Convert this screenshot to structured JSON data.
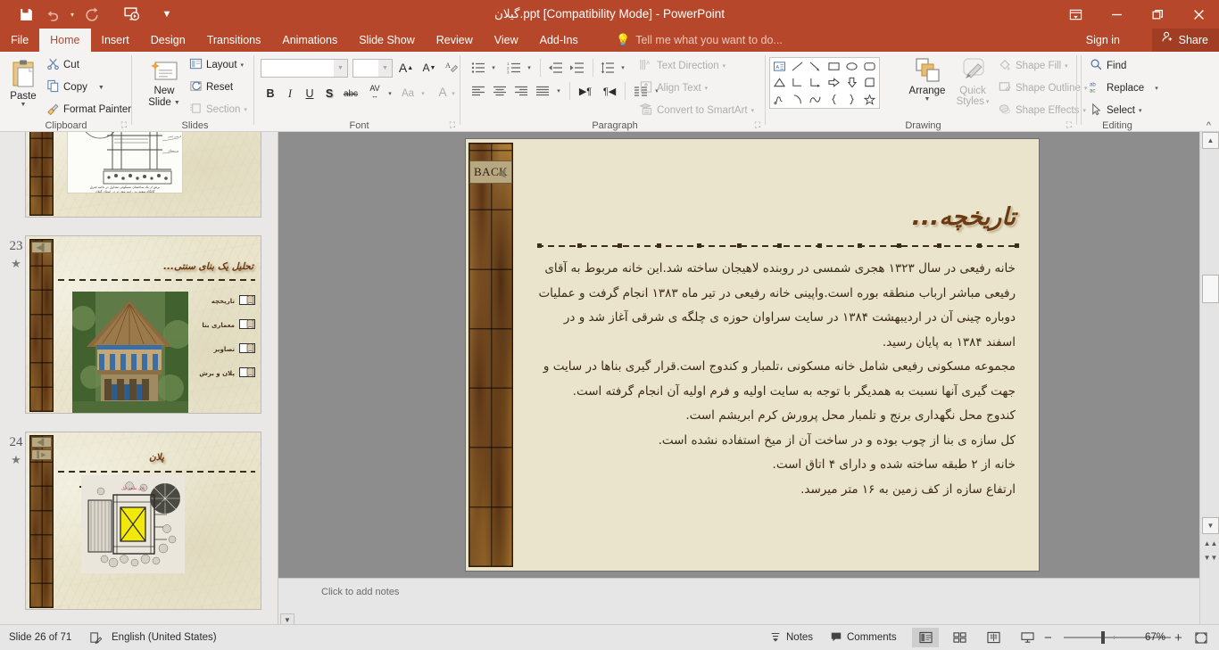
{
  "window": {
    "title": "گیلان.ppt [Compatibility Mode] - PowerPoint",
    "save_icon": "save-icon",
    "undo_icon": "undo-icon",
    "redo_icon": "redo-icon",
    "present_icon": "start-presentation-icon",
    "customize_qat_icon": "chevron-down-icon",
    "ribbon_display_icon": "ribbon-display-options-icon",
    "minimize_icon": "minimize-icon",
    "restore_icon": "restore-icon",
    "close_icon": "close-icon"
  },
  "tabs": [
    {
      "label": "File",
      "active": false
    },
    {
      "label": "Home",
      "active": true
    },
    {
      "label": "Insert",
      "active": false
    },
    {
      "label": "Design",
      "active": false
    },
    {
      "label": "Transitions",
      "active": false
    },
    {
      "label": "Animations",
      "active": false
    },
    {
      "label": "Slide Show",
      "active": false
    },
    {
      "label": "Review",
      "active": false
    },
    {
      "label": "View",
      "active": false
    },
    {
      "label": "Add-Ins",
      "active": false
    }
  ],
  "tellme": {
    "label": "Tell me what you want to do...",
    "icon": "lightbulb-icon"
  },
  "account": {
    "signin": "Sign in",
    "share": "Share",
    "share_icon": "share-person-icon"
  },
  "ribbon": {
    "groups": [
      {
        "name": "Clipboard",
        "label": "Clipboard"
      },
      {
        "name": "Slides",
        "label": "Slides"
      },
      {
        "name": "Font",
        "label": "Font"
      },
      {
        "name": "Paragraph",
        "label": "Paragraph"
      },
      {
        "name": "Drawing",
        "label": "Drawing"
      },
      {
        "name": "Editing",
        "label": "Editing"
      }
    ],
    "clipboard": {
      "paste": "Paste",
      "cut": "Cut",
      "copy": "Copy",
      "format_painter": "Format Painter"
    },
    "slides": {
      "new_slide": "New\nSlide",
      "new_slide_line1": "New",
      "new_slide_line2": "Slide",
      "layout": "Layout",
      "reset": "Reset",
      "section": "Section"
    },
    "font": {
      "font_name_value": "",
      "font_size_value": "",
      "grow_font": "A",
      "shrink_font": "A",
      "clear_formatting": "clear-formatting-icon",
      "bold": "B",
      "italic": "I",
      "underline": "U",
      "shadow": "S",
      "strikethrough": "abc",
      "character_spacing": "AV",
      "change_case": "Aa",
      "font_color": "A"
    },
    "paragraph": {
      "text_direction": "Text Direction",
      "align_text": "Align Text",
      "convert_smartart": "Convert to SmartArt"
    },
    "drawing": {
      "arrange": "Arrange",
      "quick_styles_line1": "Quick",
      "quick_styles_line2": "Styles",
      "shape_fill": "Shape Fill",
      "shape_outline": "Shape Outline",
      "shape_effects": "Shape Effects",
      "shapes": [
        "textbox",
        "line",
        "arrow",
        "rectangle",
        "oval",
        "rounded-rect",
        "triangle",
        "elbow-connector",
        "elbow-arrow-connector",
        "block-arrow-right",
        "block-arrow-down",
        "pie-shape",
        "scribble",
        "arc",
        "curve",
        "left-brace",
        "right-brace",
        "star"
      ]
    },
    "editing": {
      "find": "Find",
      "replace": "Replace",
      "select": "Select",
      "collapse_ribbon": "collapse-ribbon-icon"
    }
  },
  "thumbnails": [
    {
      "number": "",
      "star": false,
      "title": "",
      "kind": "section-drawing",
      "caption": "برش از یک ساختمان مسکونی متداول در ناحیه شرق\nگالگاه سفیدرود - ابیه پیش تر در استان گیلان"
    },
    {
      "number": "23",
      "star": true,
      "title": "تحلیل یک بنای سنتی...",
      "kind": "menu-photo",
      "menu": [
        "تاریخچه",
        "معماری بنا",
        "تصاویر",
        "پلان و برش"
      ]
    },
    {
      "number": "24",
      "star": true,
      "title": "پلان",
      "kind": "plan-drawing",
      "plan_caption": "پلان طبقه اول"
    }
  ],
  "slide": {
    "back_button": "BACK",
    "title": "تاریخچه...",
    "paragraphs": [
      "خانه رفیعی در سال ۱۳۲۳ هجری شمسی در روبنده لاهیجان ساخته شد.این خانه مربوط به آقای رفیعی مباشر ارباب منطقه بوره است.واپینی خانه رفیعی در تیر ماه ۱۳۸۳ انجام گرفت و عملیات دوباره چینی آن در اردیبهشت ۱۳۸۴ در سایت سراوان حوزه ی چلگه ی شرقی آغاز شد و در اسفند ۱۳۸۴ به پایان رسید.",
      "مجموعه مسکونی رفیعی شامل خانه مسکونی ،تلمبار و کندوج است.قرار گیری بناها در سایت و جهت گیری آنها نسبت به همدیگر با توجه به سایت اولیه و فرم اولیه آن انجام گرفته است.",
      "کندوج محل نگهداری برنج و تلمبار محل پرورش کرم ابریشم است.",
      "کل سازه ی بنا از چوب بوده و در ساخت آن از میخ استفاده نشده است.",
      "خانه از ۲ طبقه ساخته شده و دارای ۴ اتاق است.",
      "ارتفاع سازه از کف زمین به ۱۶ متر میرسد."
    ]
  },
  "notes": {
    "placeholder": "Click to add notes"
  },
  "statusbar": {
    "slide_counter": "Slide 26 of 71",
    "proofing_icon": "spellcheck-icon",
    "language": "English (United States)",
    "notes_label": "Notes",
    "notes_icon": "notes-icon",
    "comments_label": "Comments",
    "comments_icon": "comment-icon",
    "view_normal_icon": "normal-view-icon",
    "view_sorter_icon": "slide-sorter-icon",
    "view_reading_icon": "reading-view-icon",
    "view_slideshow_icon": "slideshow-view-icon",
    "zoom_out_icon": "zoom-out-icon",
    "zoom_in_icon": "zoom-in-icon",
    "zoom_value": "67%",
    "fit_slide_icon": "fit-slide-to-window-icon"
  },
  "colors": {
    "accent": "#b7472a",
    "accent_dark": "#a03d22",
    "ribbon_bg": "#f4f3f2",
    "slide_bg": "#e9e4cb",
    "slide_title": "#6b3a14"
  }
}
